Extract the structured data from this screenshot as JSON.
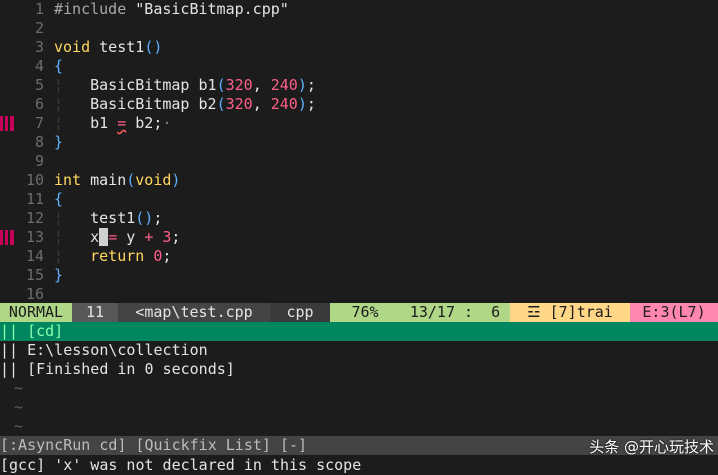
{
  "editor": {
    "lines": [
      {
        "n": "1",
        "parts": [
          {
            "c": "pp",
            "t": "#include "
          },
          {
            "c": "str",
            "t": "\"BasicBitmap.cpp\""
          }
        ]
      },
      {
        "n": "2",
        "parts": []
      },
      {
        "n": "3",
        "parts": [
          {
            "c": "kw",
            "t": "void"
          },
          {
            "c": "",
            "t": " test1"
          },
          {
            "c": "brace",
            "t": "()"
          }
        ]
      },
      {
        "n": "4",
        "parts": [
          {
            "c": "brace",
            "t": "{"
          }
        ]
      },
      {
        "n": "5",
        "parts": [
          {
            "c": "guide",
            "t": "¦   "
          },
          {
            "c": "",
            "t": "BasicBitmap b1"
          },
          {
            "c": "brace",
            "t": "("
          },
          {
            "c": "num",
            "t": "320"
          },
          {
            "c": "",
            "t": ", "
          },
          {
            "c": "num",
            "t": "240"
          },
          {
            "c": "brace",
            "t": ")"
          },
          {
            "c": "",
            "t": ";"
          }
        ]
      },
      {
        "n": "6",
        "parts": [
          {
            "c": "guide",
            "t": "¦   "
          },
          {
            "c": "",
            "t": "BasicBitmap b2"
          },
          {
            "c": "brace",
            "t": "("
          },
          {
            "c": "num",
            "t": "320"
          },
          {
            "c": "",
            "t": ", "
          },
          {
            "c": "num",
            "t": "240"
          },
          {
            "c": "brace",
            "t": ")"
          },
          {
            "c": "",
            "t": ";"
          }
        ]
      },
      {
        "n": "7",
        "sign": true,
        "parts": [
          {
            "c": "guide",
            "t": "¦   "
          },
          {
            "c": "",
            "t": "b1 "
          },
          {
            "c": "op squiggle",
            "t": "="
          },
          {
            "c": "",
            "t": " b2;"
          },
          {
            "c": "trail",
            "t": "·"
          }
        ]
      },
      {
        "n": "8",
        "parts": [
          {
            "c": "brace",
            "t": "}"
          }
        ]
      },
      {
        "n": "9",
        "parts": []
      },
      {
        "n": "10",
        "parts": [
          {
            "c": "kw",
            "t": "int"
          },
          {
            "c": "",
            "t": " main"
          },
          {
            "c": "brace",
            "t": "("
          },
          {
            "c": "kw",
            "t": "void"
          },
          {
            "c": "brace",
            "t": ")"
          }
        ]
      },
      {
        "n": "11",
        "parts": [
          {
            "c": "brace",
            "t": "{"
          }
        ]
      },
      {
        "n": "12",
        "parts": [
          {
            "c": "guide",
            "t": "¦   "
          },
          {
            "c": "",
            "t": "test1"
          },
          {
            "c": "brace",
            "t": "()"
          },
          {
            "c": "",
            "t": ";"
          }
        ]
      },
      {
        "n": "13",
        "sign": true,
        "parts": [
          {
            "c": "guide",
            "t": "¦   "
          },
          {
            "c": "",
            "t": "x"
          },
          {
            "c": "cursor",
            "t": " "
          },
          {
            "c": "op",
            "t": "="
          },
          {
            "c": "",
            "t": " y "
          },
          {
            "c": "op",
            "t": "+"
          },
          {
            "c": "",
            "t": " "
          },
          {
            "c": "num",
            "t": "3"
          },
          {
            "c": "",
            "t": ";"
          }
        ]
      },
      {
        "n": "14",
        "parts": [
          {
            "c": "guide",
            "t": "¦   "
          },
          {
            "c": "kw",
            "t": "return"
          },
          {
            "c": "",
            "t": " "
          },
          {
            "c": "num",
            "t": "0"
          },
          {
            "c": "",
            "t": ";"
          }
        ]
      },
      {
        "n": "15",
        "parts": [
          {
            "c": "brace",
            "t": "}"
          }
        ]
      },
      {
        "n": "16",
        "parts": []
      }
    ]
  },
  "statusline": {
    "mode": "NORMAL",
    "buffer": "11",
    "file": "<map\\test.cpp",
    "filetype": "cpp",
    "percent": "76%",
    "position": "13/17 :  6",
    "warnings": "☲ [7]trai",
    "errors": "E:3(L7)"
  },
  "quickfix": {
    "header": "|| [cd]",
    "lines": [
      "|| E:\\lesson\\collection",
      "|| [Finished in 0 seconds]"
    ],
    "tildes": [
      "~",
      "~",
      "~"
    ],
    "status": "[:AsyncRun cd] [Quickfix List] [-]"
  },
  "cmdline": "[gcc] 'x' was not declared in this scope",
  "watermark": "头条 @开心玩技术"
}
